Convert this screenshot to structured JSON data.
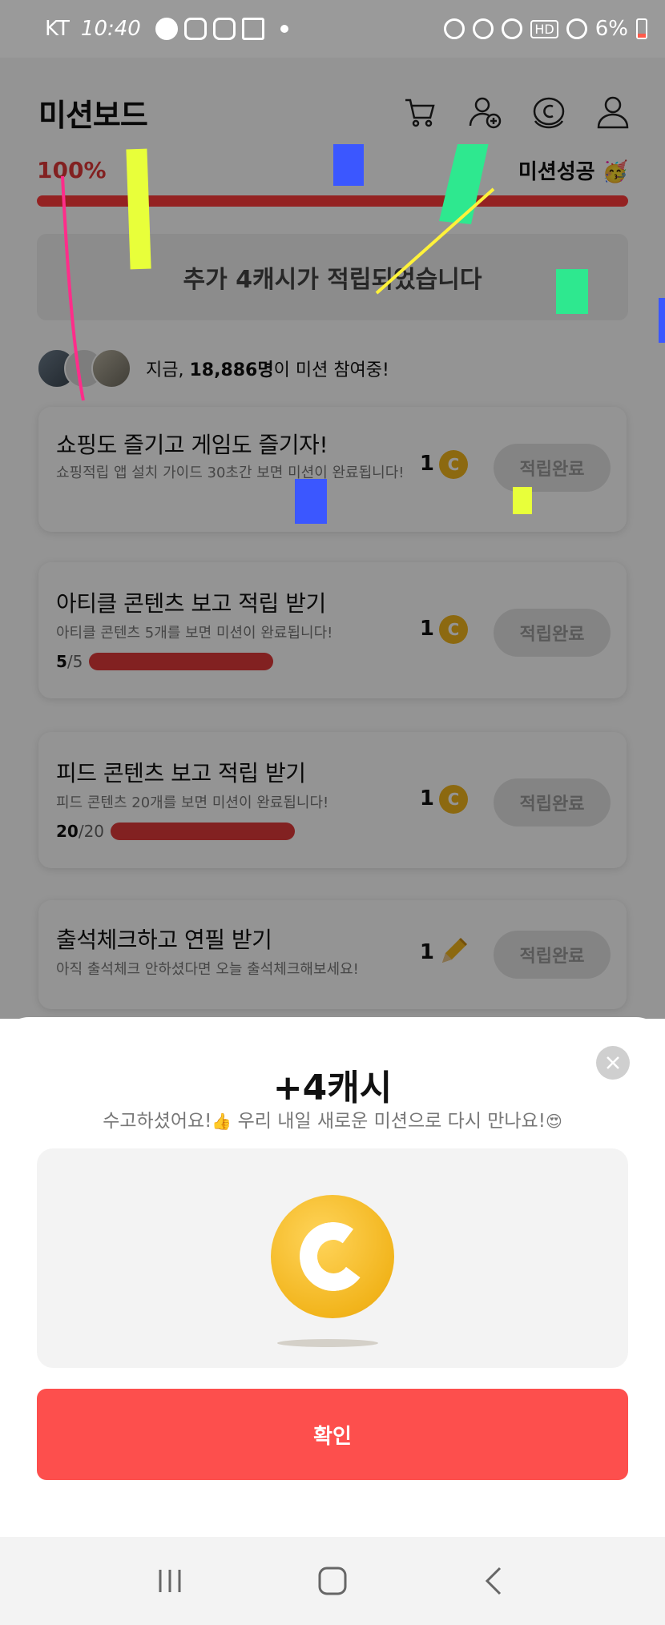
{
  "status_bar": {
    "carrier": "KT",
    "time": "10:40",
    "battery": "6%",
    "hd": "HD"
  },
  "header": {
    "title": "미션보드",
    "icons": [
      "cart-icon",
      "add-friend-icon",
      "cash-coin-icon",
      "profile-icon"
    ]
  },
  "progress": {
    "percent_label": "100%",
    "value": 100,
    "success_label": "미션성공 🥳"
  },
  "notice": "추가 4캐시가 적립되었습니다",
  "participants": {
    "prefix": "지금, ",
    "count": "18,886명",
    "suffix": "이 미션 참여중!"
  },
  "missions": [
    {
      "title": "쇼핑도 즐기고 게임도 즐기자!",
      "desc": "쇼핑적립 앱 설치 가이드 30초간 보면 미션이 완료됩니다!",
      "reward": "1",
      "reward_icon": "coin-icon",
      "button": "적립완료"
    },
    {
      "title": "아티클 콘텐츠 보고 적립 받기",
      "desc": "아티클 콘텐츠 5개를 보면 미션이 완료됩니다!",
      "progress_done": "5",
      "progress_total": "/5",
      "progress_value": 1.0,
      "reward": "1",
      "reward_icon": "coin-icon",
      "button": "적립완료"
    },
    {
      "title": "피드 콘텐츠 보고 적립 받기",
      "desc": "피드 콘텐츠 20개를 보면 미션이 완료됩니다!",
      "progress_done": "20",
      "progress_total": "/20",
      "progress_value": 1.0,
      "reward": "1",
      "reward_icon": "coin-icon",
      "button": "적립완료"
    },
    {
      "title": "출석체크하고 연필 받기",
      "desc": "아직 출석체크 안하셨다면 오늘 출석체크해보세요!",
      "reward": "1",
      "reward_icon": "pencil-icon",
      "button": "적립완료"
    }
  ],
  "sheet": {
    "amount": "+4캐시",
    "message_part1": "수고하셨어요!",
    "message_part2": " 우리 내일 새로운 미션으로 다시 만나요!",
    "emoji1": "👍",
    "emoji2": "😍",
    "confirm_label": "확인"
  },
  "colors": {
    "accent": "#fd4f4d",
    "coin": "#f2b51d",
    "dim": "rgba(0,0,0,0.42)"
  }
}
